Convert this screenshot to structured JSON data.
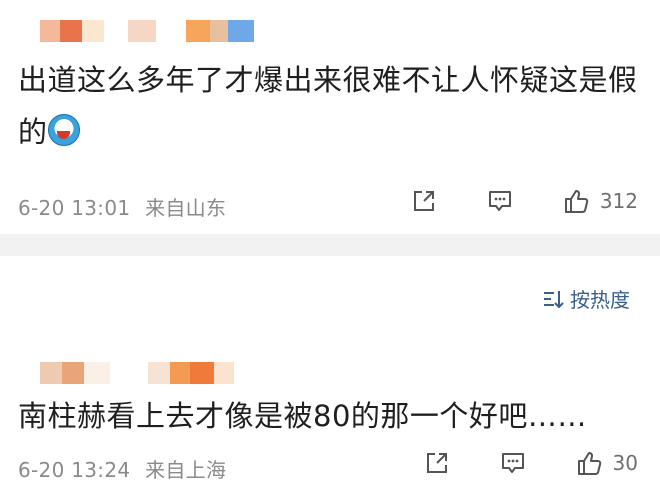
{
  "comments": [
    {
      "text": "出道这么多年了才爆出来很难不让人怀疑这是假的",
      "emoji": "doraemon-emoji",
      "timestamp": "6-20 13:01",
      "location": "来自山东",
      "likes": "312",
      "username_blur_colors": [
        "#f3b99a",
        "#e9734a",
        "#fbe6cf",
        "#f6d6c4",
        "#fbf2ea",
        "#f6a55a",
        "#e8c09e",
        "#6fa8e8"
      ]
    },
    {
      "text": "南柱赫看上去才像是被80的那一个好吧……",
      "timestamp": "6-20 13:24",
      "location": "来自上海",
      "likes": "30",
      "username_blur_colors": [
        "#eecbb0",
        "#e9a47a",
        "#fbf0e6",
        "#f6e3d3",
        "#f39a55",
        "#ef7a3a",
        "#fae4d0"
      ]
    }
  ],
  "sort": {
    "label": "按热度"
  },
  "icons": {
    "share": "share-icon",
    "comment": "comment-icon",
    "like": "thumbs-up-icon",
    "sort": "sort-icon"
  },
  "colors": {
    "meta_text": "#8a8a8a",
    "sort_text": "#3a5f8f",
    "divider": "#f2f2f2"
  }
}
